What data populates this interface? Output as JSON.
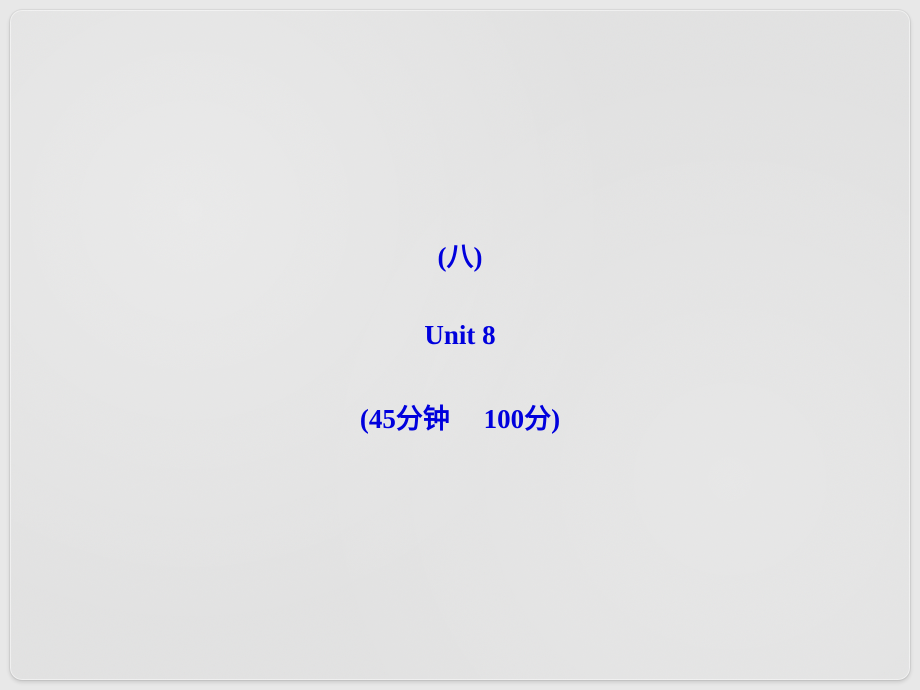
{
  "slide": {
    "line1": "(八)",
    "line2": "Unit 8",
    "line3": "(45分钟     100分)"
  },
  "colors": {
    "text": "#0000dd",
    "background": "#e2e2e2"
  }
}
